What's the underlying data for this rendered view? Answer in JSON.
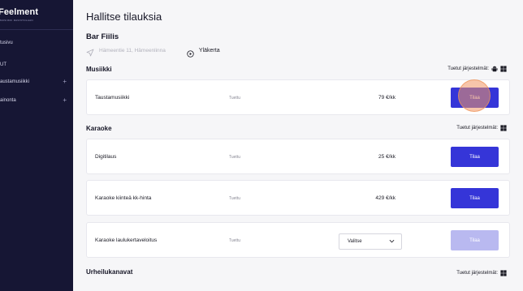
{
  "sidebar": {
    "logo": "Feelment",
    "tagline": "MUSIIKKI RAVINTOLAAN",
    "items": [
      {
        "label": "tusivu",
        "expandable": false
      },
      {
        "label": "UT",
        "expandable": false
      },
      {
        "label": "austamusiikki",
        "expandable": true
      },
      {
        "label": "ainonta",
        "expandable": true
      }
    ],
    "plus_symbol": "+"
  },
  "header": {
    "title": "Hallitse tilauksia",
    "venue_name": "Bar Fiilis",
    "address": "Hämeentie 11, Hämeenlinna",
    "floor": "Yläkerta"
  },
  "sections": [
    {
      "title": "Musiikki",
      "supported_label": "Tuetut järjestelmät:",
      "os_icons": [
        "android-icon",
        "windows-icon"
      ],
      "items": [
        {
          "name": "Taustamusiikki",
          "status": "Tuettu",
          "price": "79 €/kk",
          "action": "Tilaa",
          "enabled": true
        }
      ]
    },
    {
      "title": "Karaoke",
      "supported_label": "Tuetut järjestelmät:",
      "os_icons": [
        "windows-icon"
      ],
      "items": [
        {
          "name": "Digitilaus",
          "status": "Tuettu",
          "price": "25 €/kk",
          "action": "Tilaa",
          "enabled": true
        },
        {
          "name": "Karaoke kiinteä kk-hinta",
          "status": "Tuettu",
          "price": "429 €/kk",
          "action": "Tilaa",
          "enabled": true
        },
        {
          "name": "Karaoke laulukertaveloitus",
          "status": "Tuettu",
          "select_value": "Valitse",
          "action": "Tilaa",
          "enabled": false
        }
      ]
    },
    {
      "title": "Urheilukanavat",
      "supported_label": "Tuetut järjestelmät:",
      "os_icons": [
        "windows-icon"
      ],
      "items": []
    }
  ],
  "colors": {
    "sidebar_bg": "#161634",
    "primary_button": "#3535d8",
    "disabled_button": "#b9b9f0",
    "page_bg": "#f6f6f8"
  }
}
